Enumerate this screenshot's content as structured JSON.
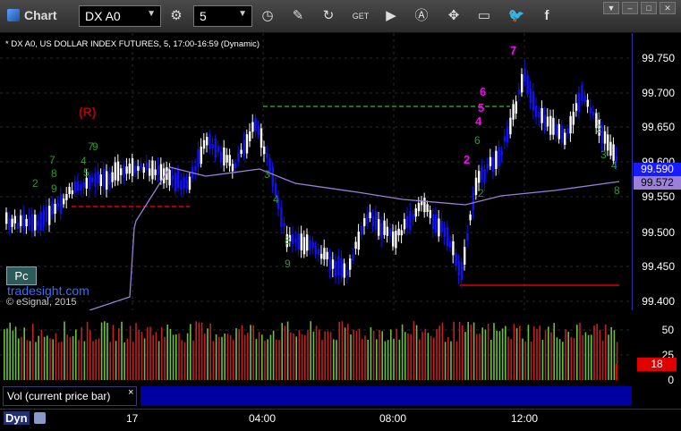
{
  "toolbar": {
    "app_title": "Chart",
    "symbol": "DX A0",
    "interval": "5",
    "buttons": [
      "link-icon",
      "interval-icon",
      "draw-icon",
      "refresh-icon",
      "get-icon",
      "play-icon",
      "alert-icon",
      "cursor-icon",
      "chat-icon",
      "twitter-icon",
      "facebook-icon"
    ]
  },
  "window_controls": [
    "▼",
    "–",
    "□",
    "✕"
  ],
  "chart": {
    "header": "* DX A0, US DOLLAR INDEX FUTURES, 5, 17:00-16:59 (Dynamic)",
    "price_ticks": [
      "99.750",
      "99.700",
      "99.650",
      "99.600",
      "99.550",
      "99.500",
      "99.450",
      "99.400"
    ],
    "last_price": "99.590",
    "ma_value": "99.572",
    "r_marker": "(R)",
    "pc_label": "Pc",
    "watermark": "tradesight.com",
    "copyright": "© eSignal, 2015",
    "markers_magenta": [
      "2",
      "4",
      "5",
      "6",
      "7"
    ],
    "colors": {
      "up": "#ffffff",
      "down": "#1010ff",
      "ma": "#9b7fd8",
      "resistance": "#2a9a2a",
      "support": "#e00000"
    }
  },
  "volume": {
    "label": "Vol (current price bar)",
    "close": "×",
    "ticks": [
      "50",
      "25",
      "0"
    ],
    "last_value": "18"
  },
  "time_axis": {
    "mode": "Dyn",
    "labels": [
      "17",
      "04:00",
      "08:00",
      "12:00"
    ]
  }
}
